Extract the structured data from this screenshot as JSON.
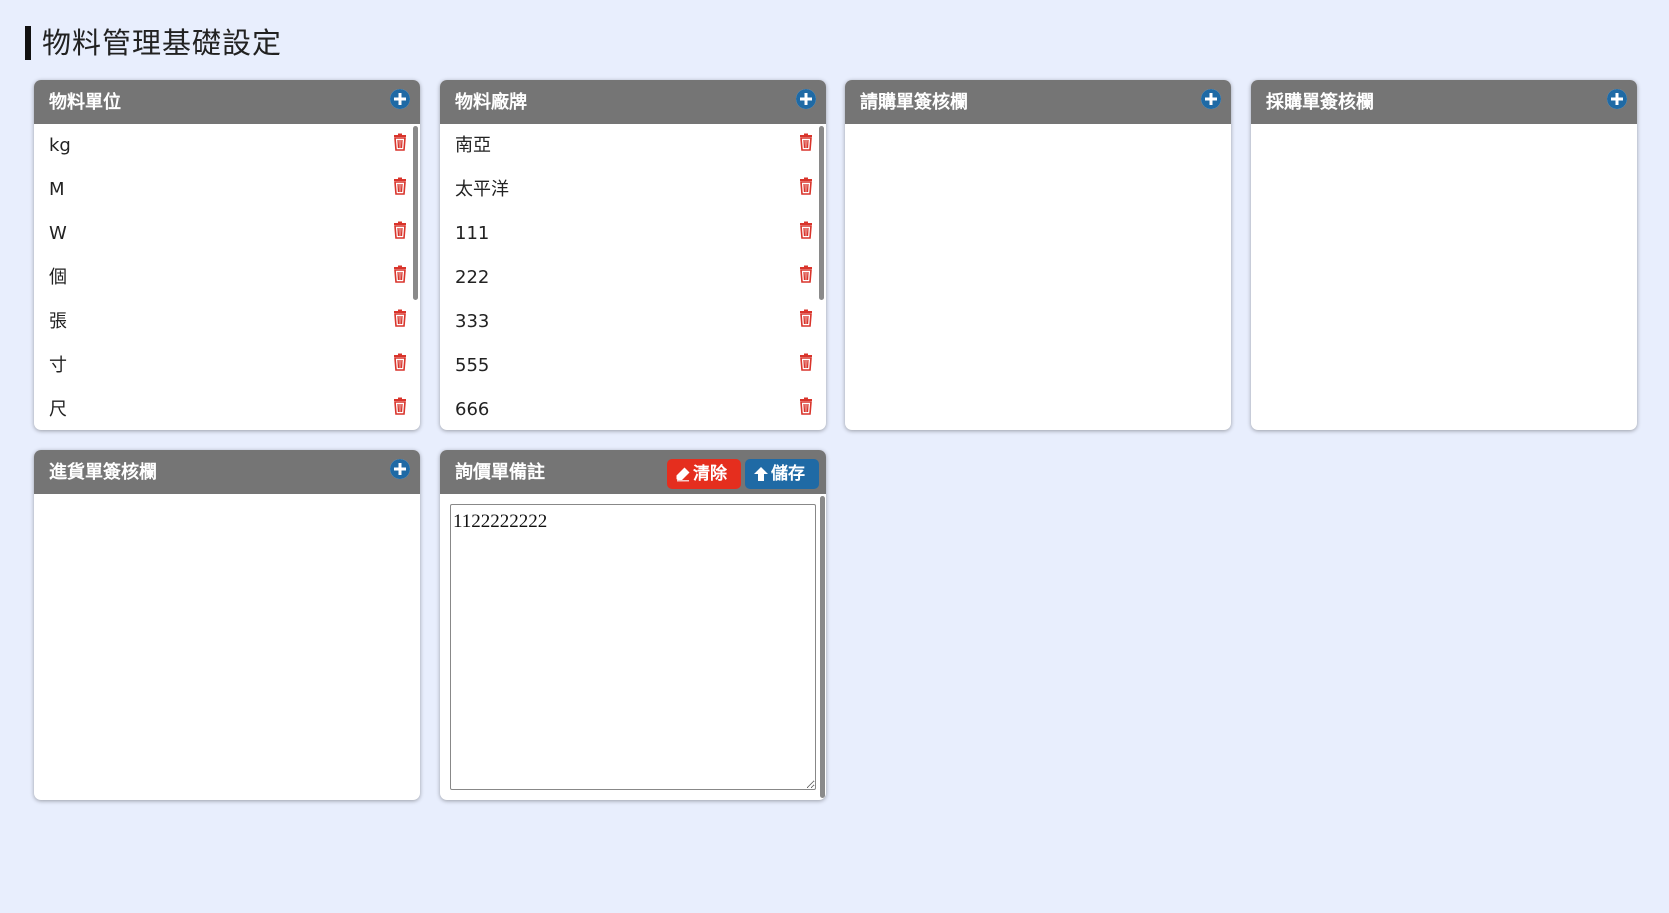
{
  "page": {
    "title": "物料管理基礎設定"
  },
  "colors": {
    "header": "#757575",
    "add": "#1f6aa5",
    "delete": "#d9342b",
    "clear": "#e52e1e",
    "save": "#1f6aa5",
    "background": "#e8eefd"
  },
  "units": {
    "title": "物料單位",
    "add_icon": "plus-circle-icon",
    "items": [
      {
        "label": "kg"
      },
      {
        "label": "M"
      },
      {
        "label": "W"
      },
      {
        "label": "個"
      },
      {
        "label": "張"
      },
      {
        "label": "寸"
      },
      {
        "label": "尺"
      }
    ]
  },
  "brands": {
    "title": "物料廠牌",
    "add_icon": "plus-circle-icon",
    "items": [
      {
        "label": "南亞"
      },
      {
        "label": "太平洋"
      },
      {
        "label": "111"
      },
      {
        "label": "222"
      },
      {
        "label": "333"
      },
      {
        "label": "555"
      },
      {
        "label": "666"
      }
    ]
  },
  "requisition": {
    "title": "請購單簽核欄",
    "add_icon": "plus-circle-icon"
  },
  "purchase": {
    "title": "採購單簽核欄",
    "add_icon": "plus-circle-icon"
  },
  "receiving": {
    "title": "進貨單簽核欄",
    "add_icon": "plus-circle-icon"
  },
  "inquiry_note": {
    "title": "詢價單備註",
    "clear_label": "清除",
    "clear_icon": "eraser-icon",
    "save_label": "儲存",
    "save_icon": "upload-arrow-icon",
    "value": "1122222222"
  }
}
